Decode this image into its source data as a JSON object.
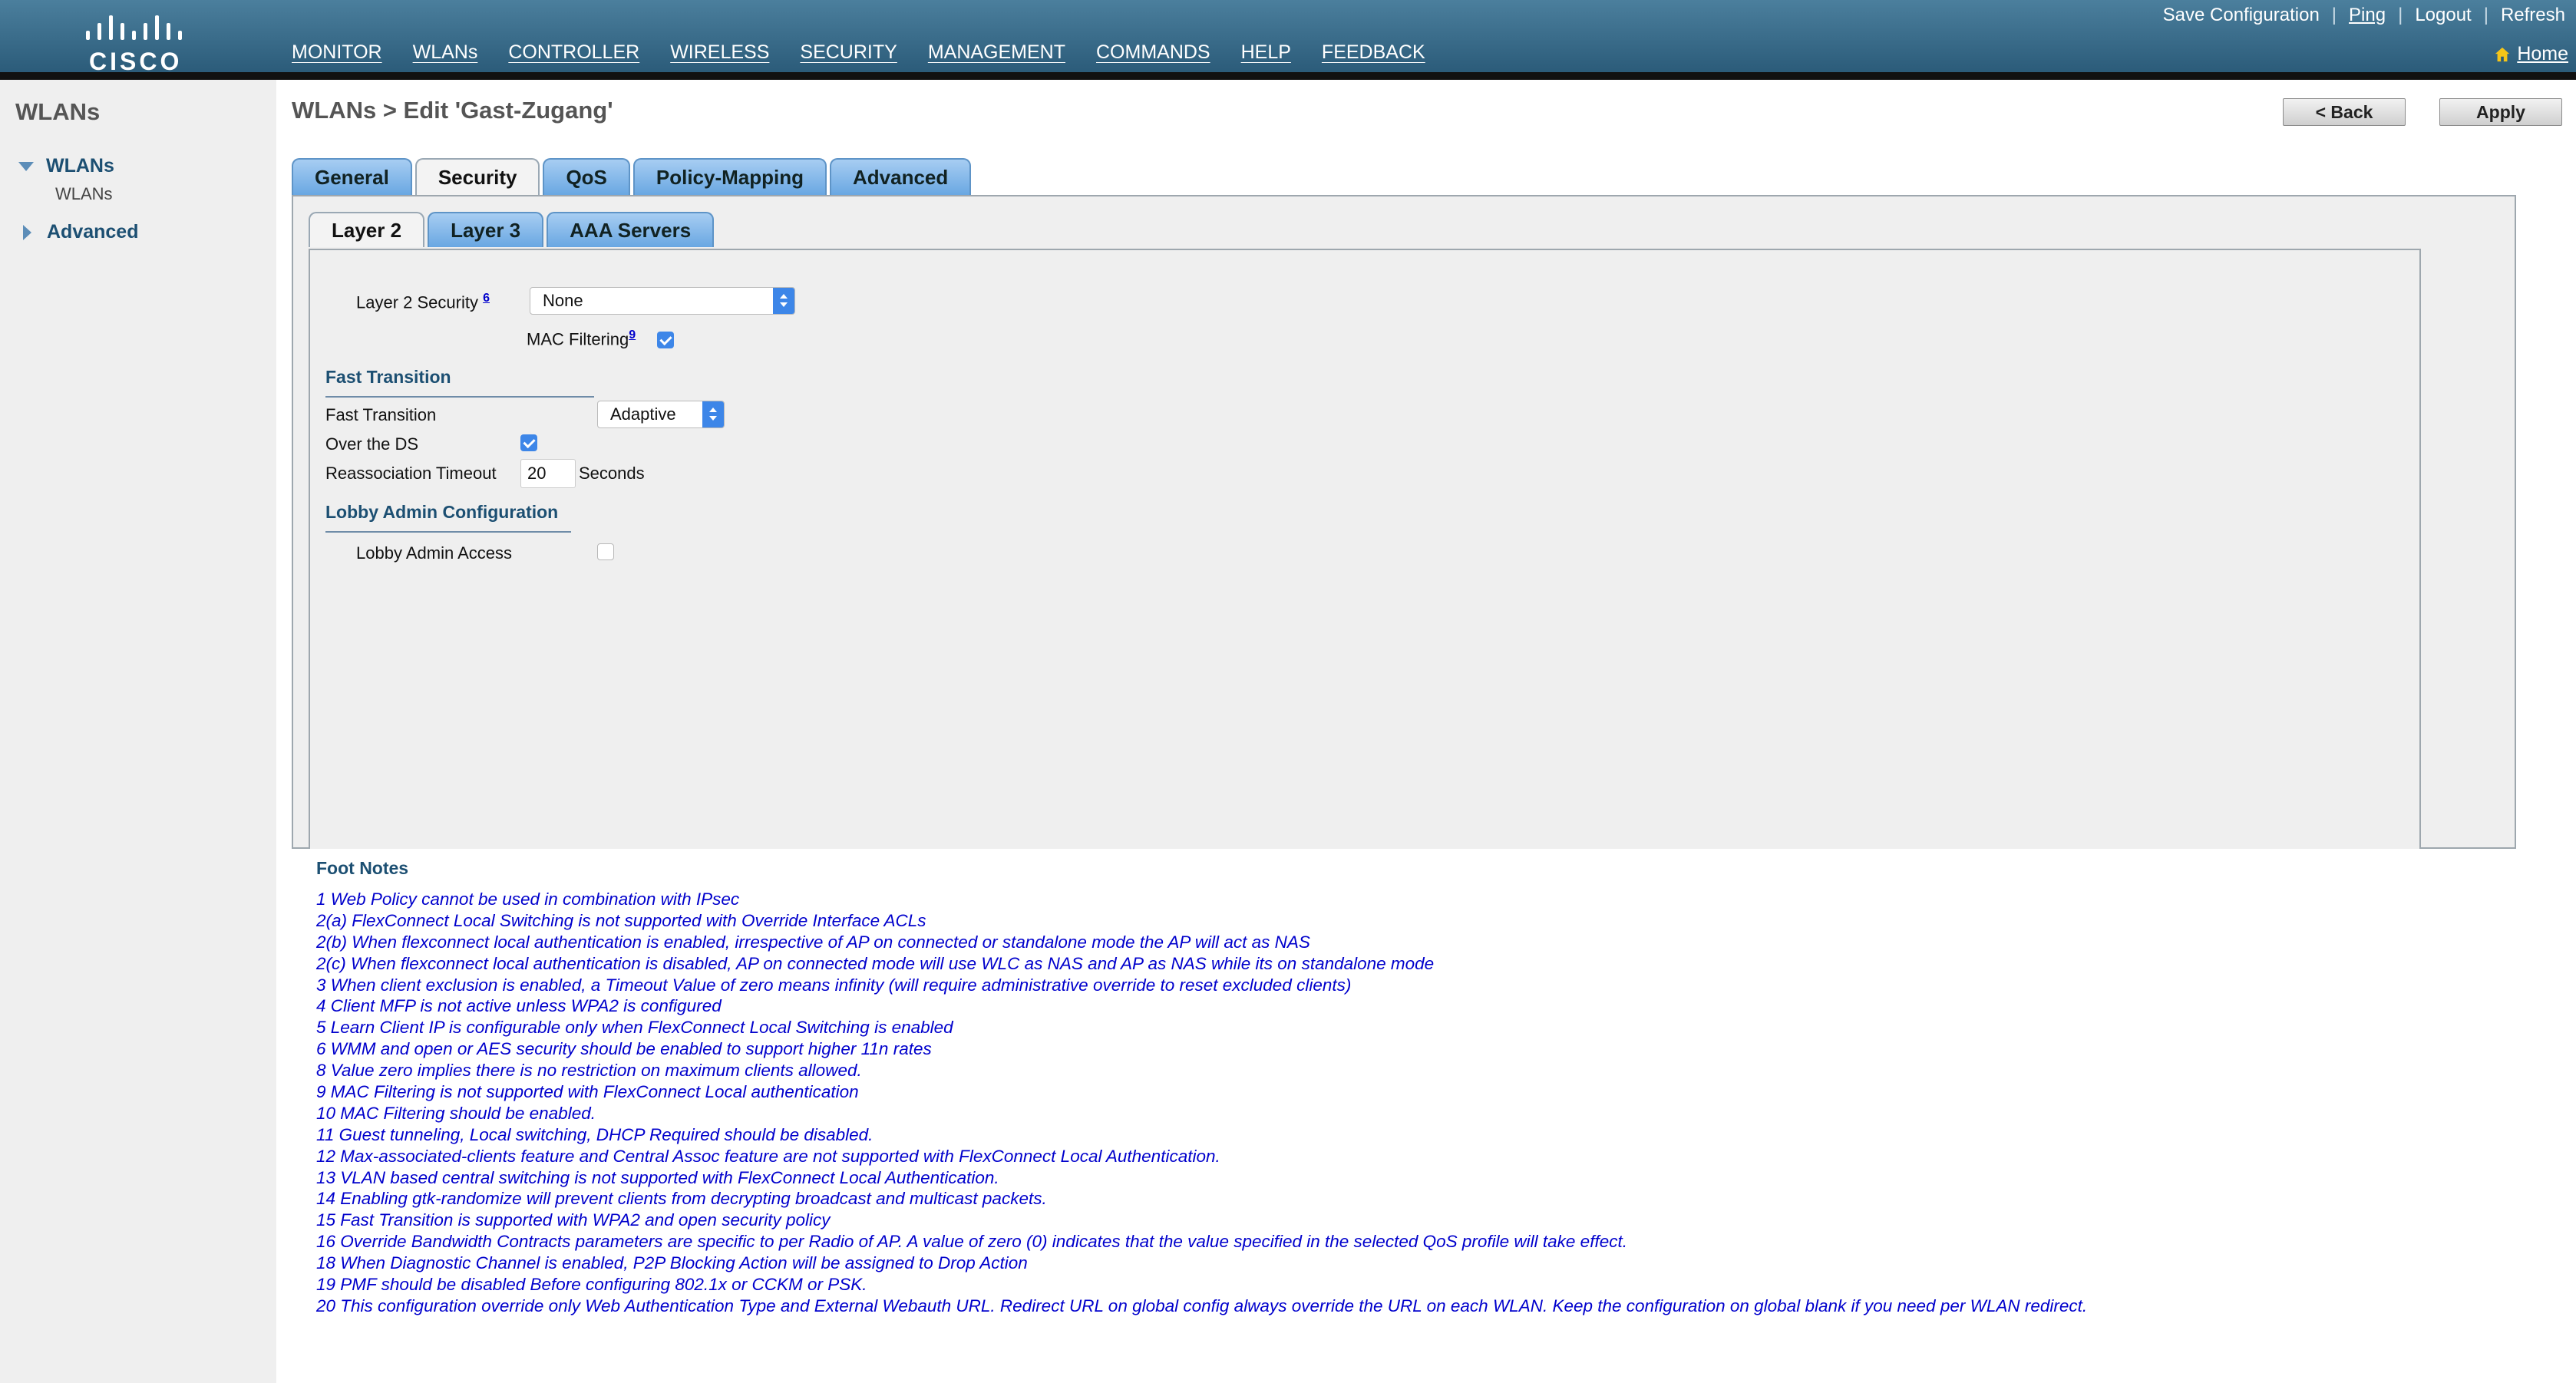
{
  "header": {
    "logo_text": "CISCO",
    "nav": [
      "MONITOR",
      "WLANs",
      "CONTROLLER",
      "WIRELESS",
      "SECURITY",
      "MANAGEMENT",
      "COMMANDS",
      "HELP",
      "FEEDBACK"
    ],
    "active_nav": "WLANs",
    "top_links": {
      "save": "Save Configuration",
      "ping": "Ping",
      "logout": "Logout",
      "refresh": "Refresh"
    },
    "home": "Home"
  },
  "sidebar": {
    "title": "WLANs",
    "items": [
      {
        "label": "WLANs",
        "expanded": true,
        "children": [
          "WLANs"
        ]
      },
      {
        "label": "Advanced",
        "expanded": false
      }
    ]
  },
  "page": {
    "title": "WLANs > Edit  'Gast-Zugang'",
    "back_label": "< Back",
    "apply_label": "Apply"
  },
  "tabs": {
    "outer": [
      "General",
      "Security",
      "QoS",
      "Policy-Mapping",
      "Advanced"
    ],
    "outer_active": "Security",
    "inner": [
      "Layer 2",
      "Layer 3",
      "AAA Servers"
    ],
    "inner_active": "Layer 2"
  },
  "layer2": {
    "security_label": "Layer 2 Security",
    "security_sup": "6",
    "security_value": "None",
    "mac_filtering_label": "MAC Filtering",
    "mac_filtering_sup": "9",
    "mac_filtering_checked": true
  },
  "fast_transition": {
    "heading": "Fast Transition",
    "ft_label": "Fast Transition",
    "ft_value": "Adaptive",
    "over_ds_label": "Over the DS",
    "over_ds_checked": true,
    "reassoc_label": "Reassociation Timeout",
    "reassoc_value": "20",
    "reassoc_unit": "Seconds"
  },
  "lobby": {
    "heading": "Lobby Admin Configuration",
    "access_label": "Lobby Admin Access",
    "access_checked": false
  },
  "foot_notes": {
    "title": "Foot Notes",
    "items": [
      "1 Web Policy cannot be used in combination with IPsec",
      "2(a) FlexConnect Local Switching is not supported with Override Interface ACLs",
      "2(b) When flexconnect local authentication is enabled, irrespective of AP on connected or standalone mode the AP will act as NAS",
      "2(c) When flexconnect local authentication is disabled, AP on connected mode will use WLC as NAS and AP as NAS while its on standalone mode",
      "3 When client exclusion is enabled, a Timeout Value of zero means infinity (will require administrative override to reset excluded clients)",
      "4 Client MFP is not active unless WPA2 is configured",
      "5 Learn Client IP is configurable only when FlexConnect Local Switching is enabled",
      "6 WMM and open or AES security should be enabled to support higher 11n rates",
      "8 Value zero implies there is no restriction on maximum clients allowed.",
      "9 MAC Filtering is not supported with FlexConnect Local authentication",
      "10 MAC Filtering should be enabled.",
      "11 Guest tunneling, Local switching, DHCP Required should be disabled.",
      "12 Max-associated-clients feature and Central Assoc feature are not supported with FlexConnect Local Authentication.",
      "13 VLAN based central switching is not supported with FlexConnect Local Authentication.",
      "14 Enabling gtk-randomize will prevent clients from decrypting broadcast and multicast packets.",
      "15 Fast Transition is supported with WPA2 and open security policy",
      "16 Override Bandwidth Contracts parameters are specific to per Radio of AP. A value of zero (0) indicates that the value specified in the selected QoS profile will take effect.",
      "18 When Diagnostic Channel is enabled, P2P Blocking Action will be assigned to Drop Action",
      "19 PMF should be disabled Before configuring 802.1x or CCKM or PSK.",
      "20 This configuration override only Web Authentication Type and External Webauth URL. Redirect URL on global config always override the URL on each WLAN. Keep the configuration on global blank if you need per WLAN redirect."
    ]
  },
  "colors": {
    "header_top": "#4b7f9d",
    "header_bottom": "#2a5a78",
    "active_nav_underline": "#f29b23",
    "tab_blue": "#69a7e2",
    "section_heading": "#1c4f72",
    "footnote_text": "#0000cc",
    "checkbox_on": "#3d86e8"
  }
}
